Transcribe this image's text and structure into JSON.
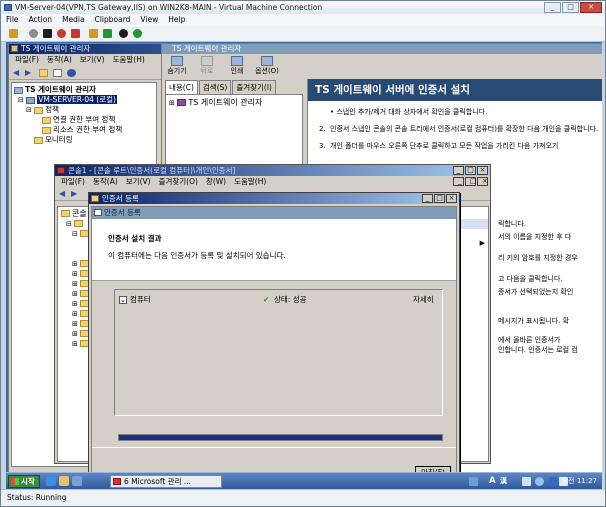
{
  "vm": {
    "title": "VM-Server-04(VPN,TS Gateway,IIS) on WIN2K8-MAIN - Virtual Machine Connection",
    "menu": [
      "File",
      "Action",
      "Media",
      "Clipboard",
      "View",
      "Help"
    ],
    "status": "Status: Running",
    "toolbar_colors": [
      "#1d1d1d",
      "#c73a2a",
      "#c73a2a",
      "#d59b1b",
      "#1f9a2a",
      "#1f6ac0"
    ]
  },
  "ts_manager": {
    "title": "TS 게이트웨이 관리자",
    "menu": [
      "파일(F)",
      "동작(A)",
      "보기(V)",
      "도움말(H)"
    ],
    "tree": {
      "root": "TS 게이트웨이 관리자",
      "server": "VM-SERVER-04 (로컬)",
      "policy": "정책",
      "child_1": "연결 권한 부여 정책",
      "child_2": "리소스 권한 부여 정책",
      "monitoring": "모니터링"
    }
  },
  "help": {
    "title": "TS 게이트웨이 관리자",
    "toolbar": [
      "숨기기",
      "뒤로",
      "인쇄",
      "옵션(O)"
    ],
    "tabs": [
      "내용(C)",
      "검색(S)",
      "즐겨찾기(I)"
    ],
    "toc_item": "TS 게이트웨이 관리자",
    "heading": "TS 게이트웨이 서버에 인증서 설치",
    "bullet": "• 스냅인 추가/제거 대화 상자에서 확인을 클릭합니다.",
    "step_2_num": "2.",
    "step_2": "인증서 스냅인 콘솔의 콘솔 트리에서 인증서(로컬 컴퓨터)를 확장한 다음 개인을 클릭합니다.",
    "step_3_num": "3.",
    "step_3": "개인 폴더를 마우스 오른쪽 단추로 클릭하고 모든 작업을 가리킨 다음 가져오기",
    "frag_1": "릭합니다.",
    "frag_2": "서의 이름을 지정한 후 다",
    "frag_3": "리 키의 암호를 지정한 경우",
    "frag_4": "고 다음을 클릭합니다.",
    "frag_5": "증서가 선택되었는지 확인",
    "frag_6": "메시지가 표시됩니다. 확",
    "frag_7": "에서 올바른 인증서가",
    "frag_8": "인합니다. 인증서는 로컬 컴"
  },
  "console": {
    "title": "콘솔1 - [콘솔 루트\\인증서(로컬 컴퓨터)\\개인\\인증서]",
    "menu": [
      "파일(F)",
      "동작(A)",
      "보기(V)",
      "즐겨찾기(O)",
      "창(W)",
      "도움말(H)"
    ],
    "tree_frag": "콘솔 루"
  },
  "dialog": {
    "outer_title": "인증서 등록",
    "inner_title": "인증서 등록",
    "result_title": "인증서 설치 결과",
    "result_desc": "이 컴퓨터에는 다음 인증서가 등록 및 설치되어 있습니다.",
    "item_name": "컴퓨터",
    "item_status": "상태: 성공",
    "item_detail": "자세히",
    "finish_button": "마침(F)",
    "progress": 1.0
  },
  "taskbar": {
    "start": "시작",
    "task": "6 Microsoft 관리 ...",
    "tray_a": "A",
    "tray_kor": "漢",
    "clock": "오전 11:27"
  }
}
